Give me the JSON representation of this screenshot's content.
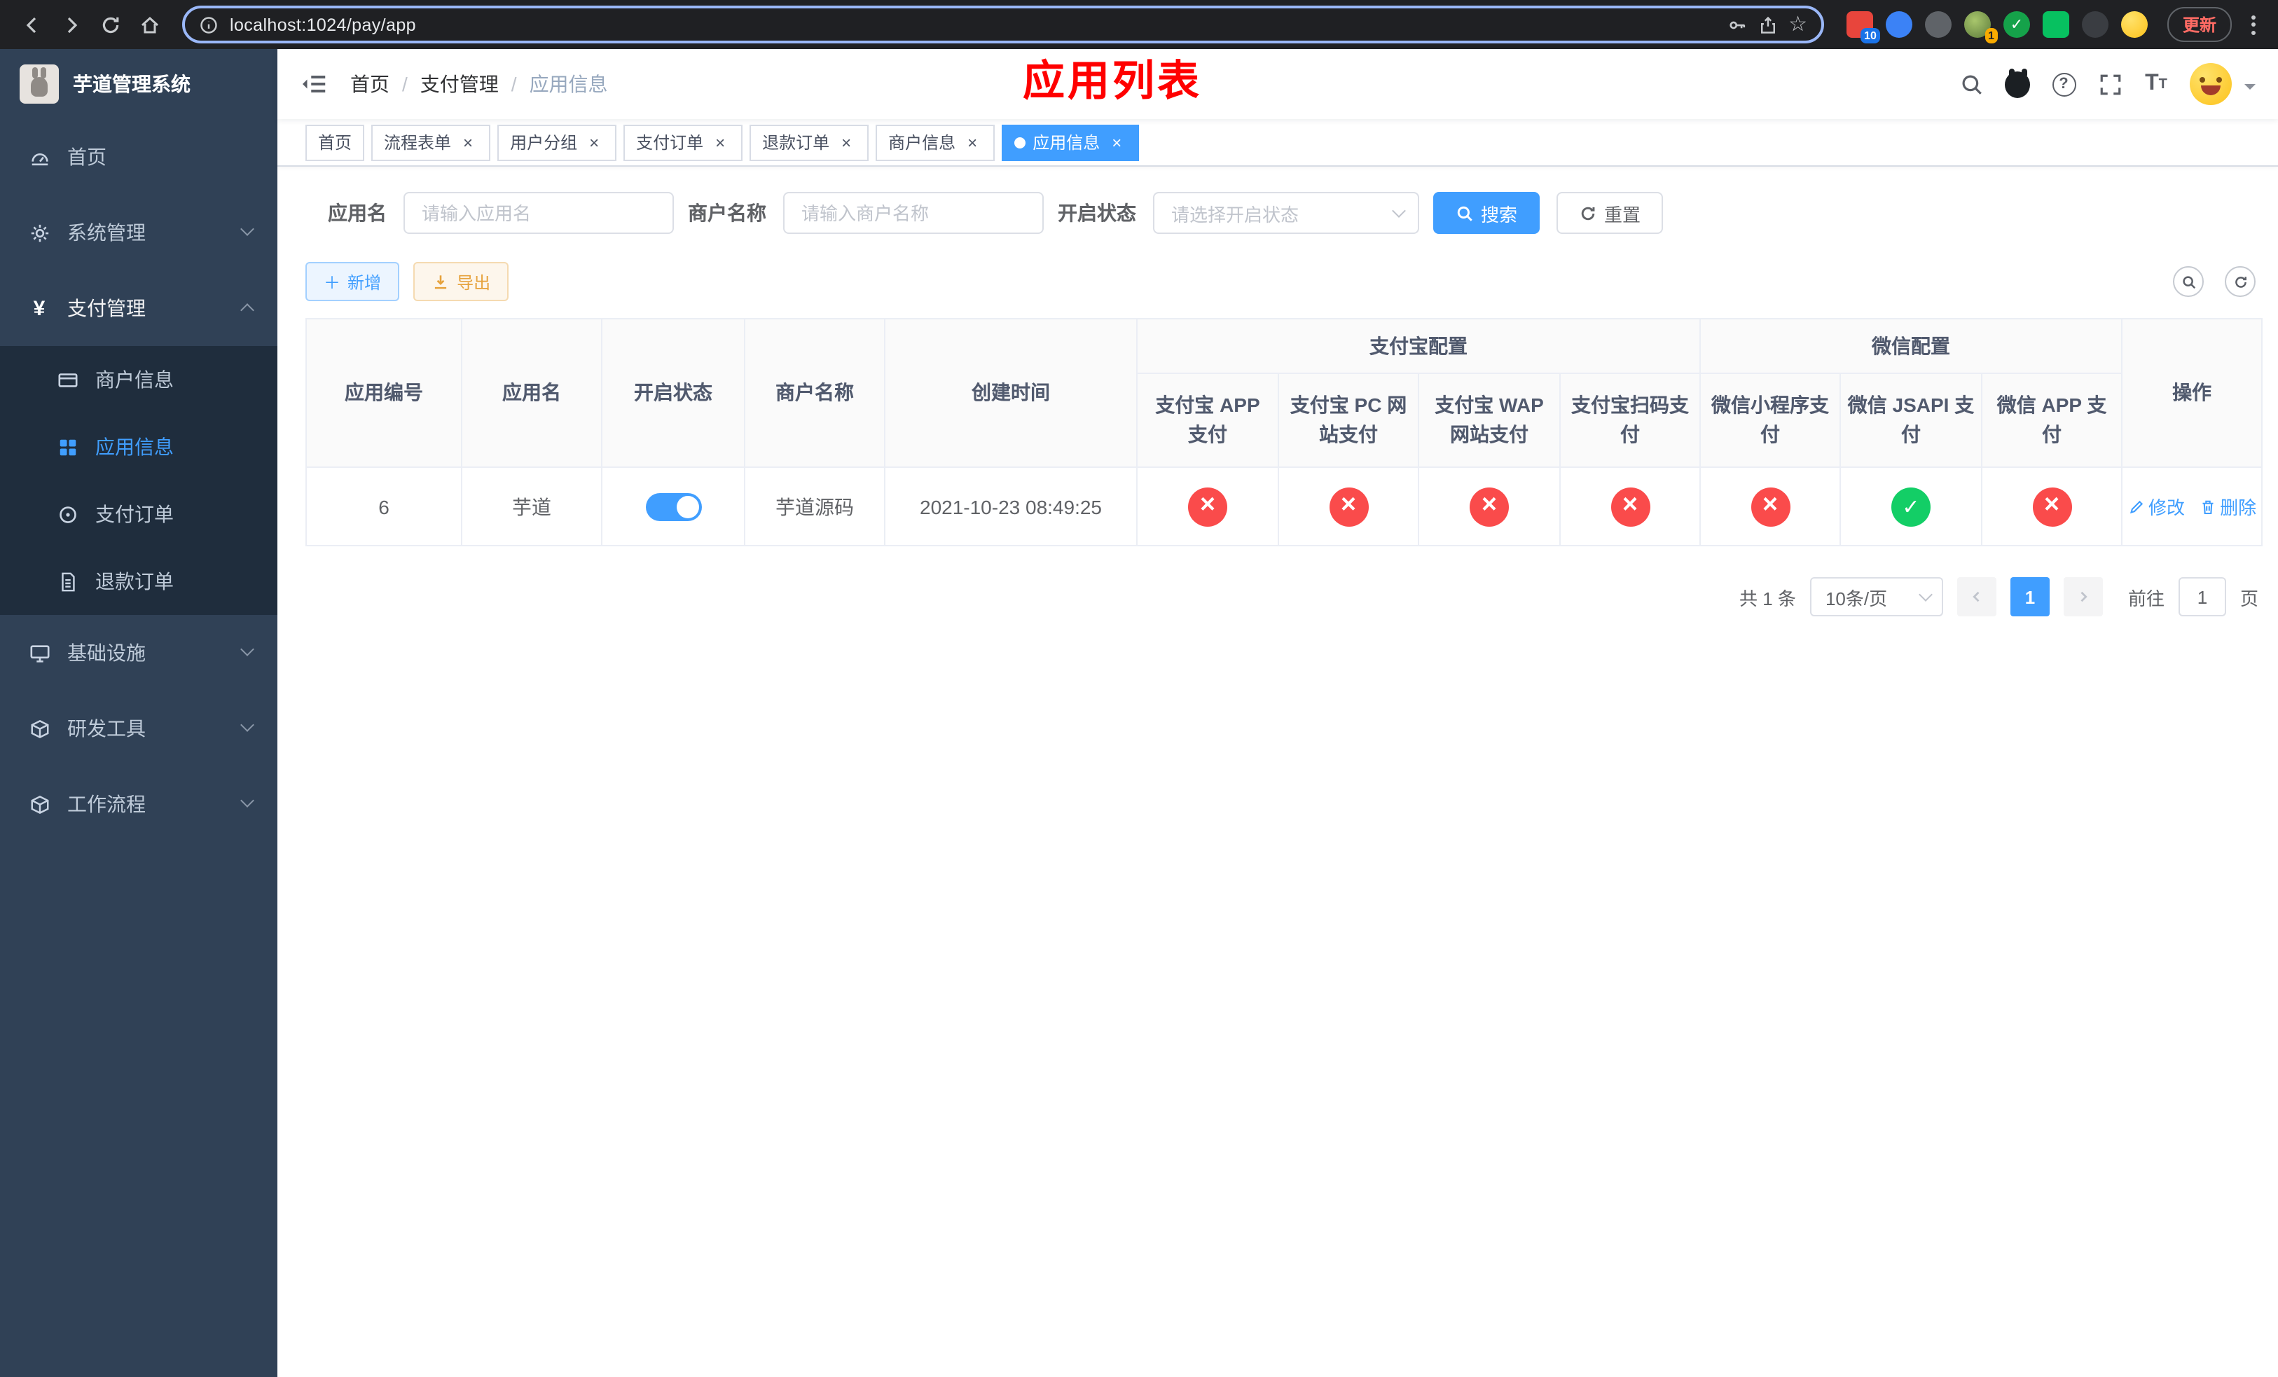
{
  "browser": {
    "url": "localhost:1024/pay/app",
    "update_label": "更新",
    "badge_10": "10",
    "badge_1": "1"
  },
  "app_title_overlay": "应用列表",
  "sidebar": {
    "title": "芋道管理系统",
    "home": "首页",
    "system": "系统管理",
    "pay": "支付管理",
    "pay_children": {
      "merchant": "商户信息",
      "app": "应用信息",
      "order": "支付订单",
      "refund": "退款订单"
    },
    "infra": "基础设施",
    "devtools": "研发工具",
    "workflow": "工作流程"
  },
  "breadcrumb": {
    "home": "首页",
    "pay": "支付管理",
    "current": "应用信息",
    "separator": "/"
  },
  "tabs": [
    {
      "label": "首页"
    },
    {
      "label": "流程表单"
    },
    {
      "label": "用户分组"
    },
    {
      "label": "支付订单"
    },
    {
      "label": "退款订单"
    },
    {
      "label": "商户信息"
    },
    {
      "label": "应用信息"
    }
  ],
  "filters": {
    "app_name_label": "应用名",
    "app_name_placeholder": "请输入应用名",
    "merchant_label": "商户名称",
    "merchant_placeholder": "请输入商户名称",
    "status_label": "开启状态",
    "status_placeholder": "请选择开启状态",
    "search_label": "搜索",
    "reset_label": "重置"
  },
  "toolbar": {
    "add_label": "新增",
    "export_label": "导出"
  },
  "table": {
    "col_id": "应用编号",
    "col_name": "应用名",
    "col_status": "开启状态",
    "col_merchant": "商户名称",
    "col_created": "创建时间",
    "group_alipay": "支付宝配置",
    "group_wechat": "微信配置",
    "col_alipay_app": "支付宝 APP 支付",
    "col_alipay_pc": "支付宝 PC 网站支付",
    "col_alipay_wap": "支付宝 WAP 网站支付",
    "col_alipay_qr": "支付宝扫码支付",
    "col_wx_mini": "微信小程序支付",
    "col_wx_jsapi": "微信 JSAPI 支付",
    "col_wx_app": "微信 APP 支付",
    "col_actions": "操作",
    "rows": [
      {
        "id": "6",
        "name": "芋道",
        "enabled": true,
        "merchant": "芋道源码",
        "created": "2021-10-23 08:49:25",
        "alipay_app": false,
        "alipay_pc": false,
        "alipay_wap": false,
        "alipay_qr": false,
        "wx_mini": false,
        "wx_jsapi": true,
        "wx_app": false,
        "edit_label": "修改",
        "delete_label": "删除"
      }
    ]
  },
  "pagination": {
    "total": "共 1 条",
    "page_size": "10条/页",
    "page": "1",
    "goto": "前往",
    "goto_value": "1",
    "unit": "页"
  },
  "colors": {
    "accent": "#409eff",
    "success": "#13ce66",
    "danger": "#fa4b4b",
    "warning": "#e6a23c",
    "sidebar_bg": "#304156",
    "submenu_bg": "#1f2d3d",
    "overlay_title": "#ff0000"
  }
}
